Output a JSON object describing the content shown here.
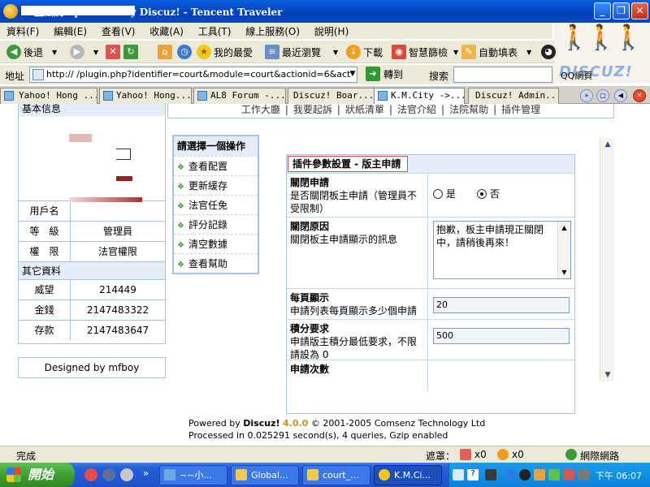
{
  "window": {
    "title": "　壹法院 - powered by Discuz! - Tencent Traveler",
    "min_label": "_",
    "max_label": "❐",
    "close_label": "✕"
  },
  "menu": [
    "資料(F)",
    "編輯(E)",
    "查看(V)",
    "收藏(A)",
    "工具(T)",
    "線上服務(O)",
    "說明(H)"
  ],
  "toolbar": {
    "back": "後退",
    "favorites": "我的最愛",
    "recent": "最近瀏覽",
    "download": "下載",
    "smart_filter": "智慧篩檢",
    "autofill": "自動填表",
    "qq": "QQ"
  },
  "address": {
    "label": "地址",
    "url": "http://               /plugin.php?identifier=court&module=court&actionid=6&act",
    "go": "轉到",
    "search_label": "搜索",
    "qq_button": "QQ網頁"
  },
  "brand": {
    "logo": "DISCUZ!"
  },
  "tabs": [
    "Yahoo! Hong ...",
    "Yahoo! Hong...",
    "AL8 Forum -...",
    "Discuz! Boar...",
    "K.M.City ->...",
    "Discuz! Admin..."
  ],
  "topnav": [
    "工作大廳",
    "|",
    "我要起訴",
    "|",
    "狀紙清單",
    "|",
    "法官介紹",
    "|",
    "法院幫助",
    "|",
    "插件管理"
  ],
  "left_panel": {
    "header": "基本信息",
    "rows": [
      {
        "k": "用戶名",
        "v": ""
      },
      {
        "k": "等　級",
        "v": "管理員"
      },
      {
        "k": "權　限",
        "v": "法官權限"
      }
    ],
    "sub_header": "其它資料",
    "stats": [
      {
        "k": "威望",
        "v": "214449"
      },
      {
        "k": "金錢",
        "v": "2147483322"
      },
      {
        "k": "存款",
        "v": "2147483647"
      }
    ],
    "designed_by": "Designed by mfboy"
  },
  "operations": {
    "header": "請選擇一個操作",
    "items": [
      "查看配置",
      "更新緩存",
      "法官任免",
      "評分記錄",
      "清空數據",
      "查看幫助"
    ]
  },
  "settings": {
    "header": "插件參數設置 - 版主申請",
    "close_apply": {
      "title": "關閉申請",
      "desc": "是否關閉板主申請（管理員不受限制）",
      "yes": "是",
      "no": "否",
      "selected": "no"
    },
    "close_reason": {
      "title": "關閉原因",
      "desc": "關閉板主申請顯示的訊息",
      "value": "抱歉，板主申請現正關閉中，請稍後再來！"
    },
    "per_page": {
      "title": "每頁顯示",
      "desc": "申請列表每頁顯示多少個申請",
      "value": "20"
    },
    "credit_req": {
      "title": "積分要求",
      "desc": "申請版主積分最低要求，不限請設為 0",
      "value": "500"
    },
    "apply_count": {
      "title": "申請次數"
    }
  },
  "footer": {
    "powered": "Powered by",
    "brand": "Discuz!",
    "version": "4.0.0",
    "copyright": "© 2001-2005 Comsenz Technology Ltd",
    "processed": "Processed in 0.025291 second(s), 4 queries, Gzip enabled"
  },
  "status": {
    "done": "完成",
    "block_label": "遮罩：",
    "popup_count": "x0",
    "ad_count": "x0",
    "network": "網際網路"
  },
  "taskbar": {
    "start": "開始",
    "tasks": [
      "~~小...",
      "Global...",
      "court_...",
      "K.M.Ci..."
    ],
    "clock": "下午 06:07"
  },
  "colors": {
    "title_bar": "#0040b8",
    "panel_border": "#a6c4e6",
    "panel_header": "#e4edf8",
    "highlight_border": "#e04a4a",
    "discuz_version": "#d2901a"
  }
}
